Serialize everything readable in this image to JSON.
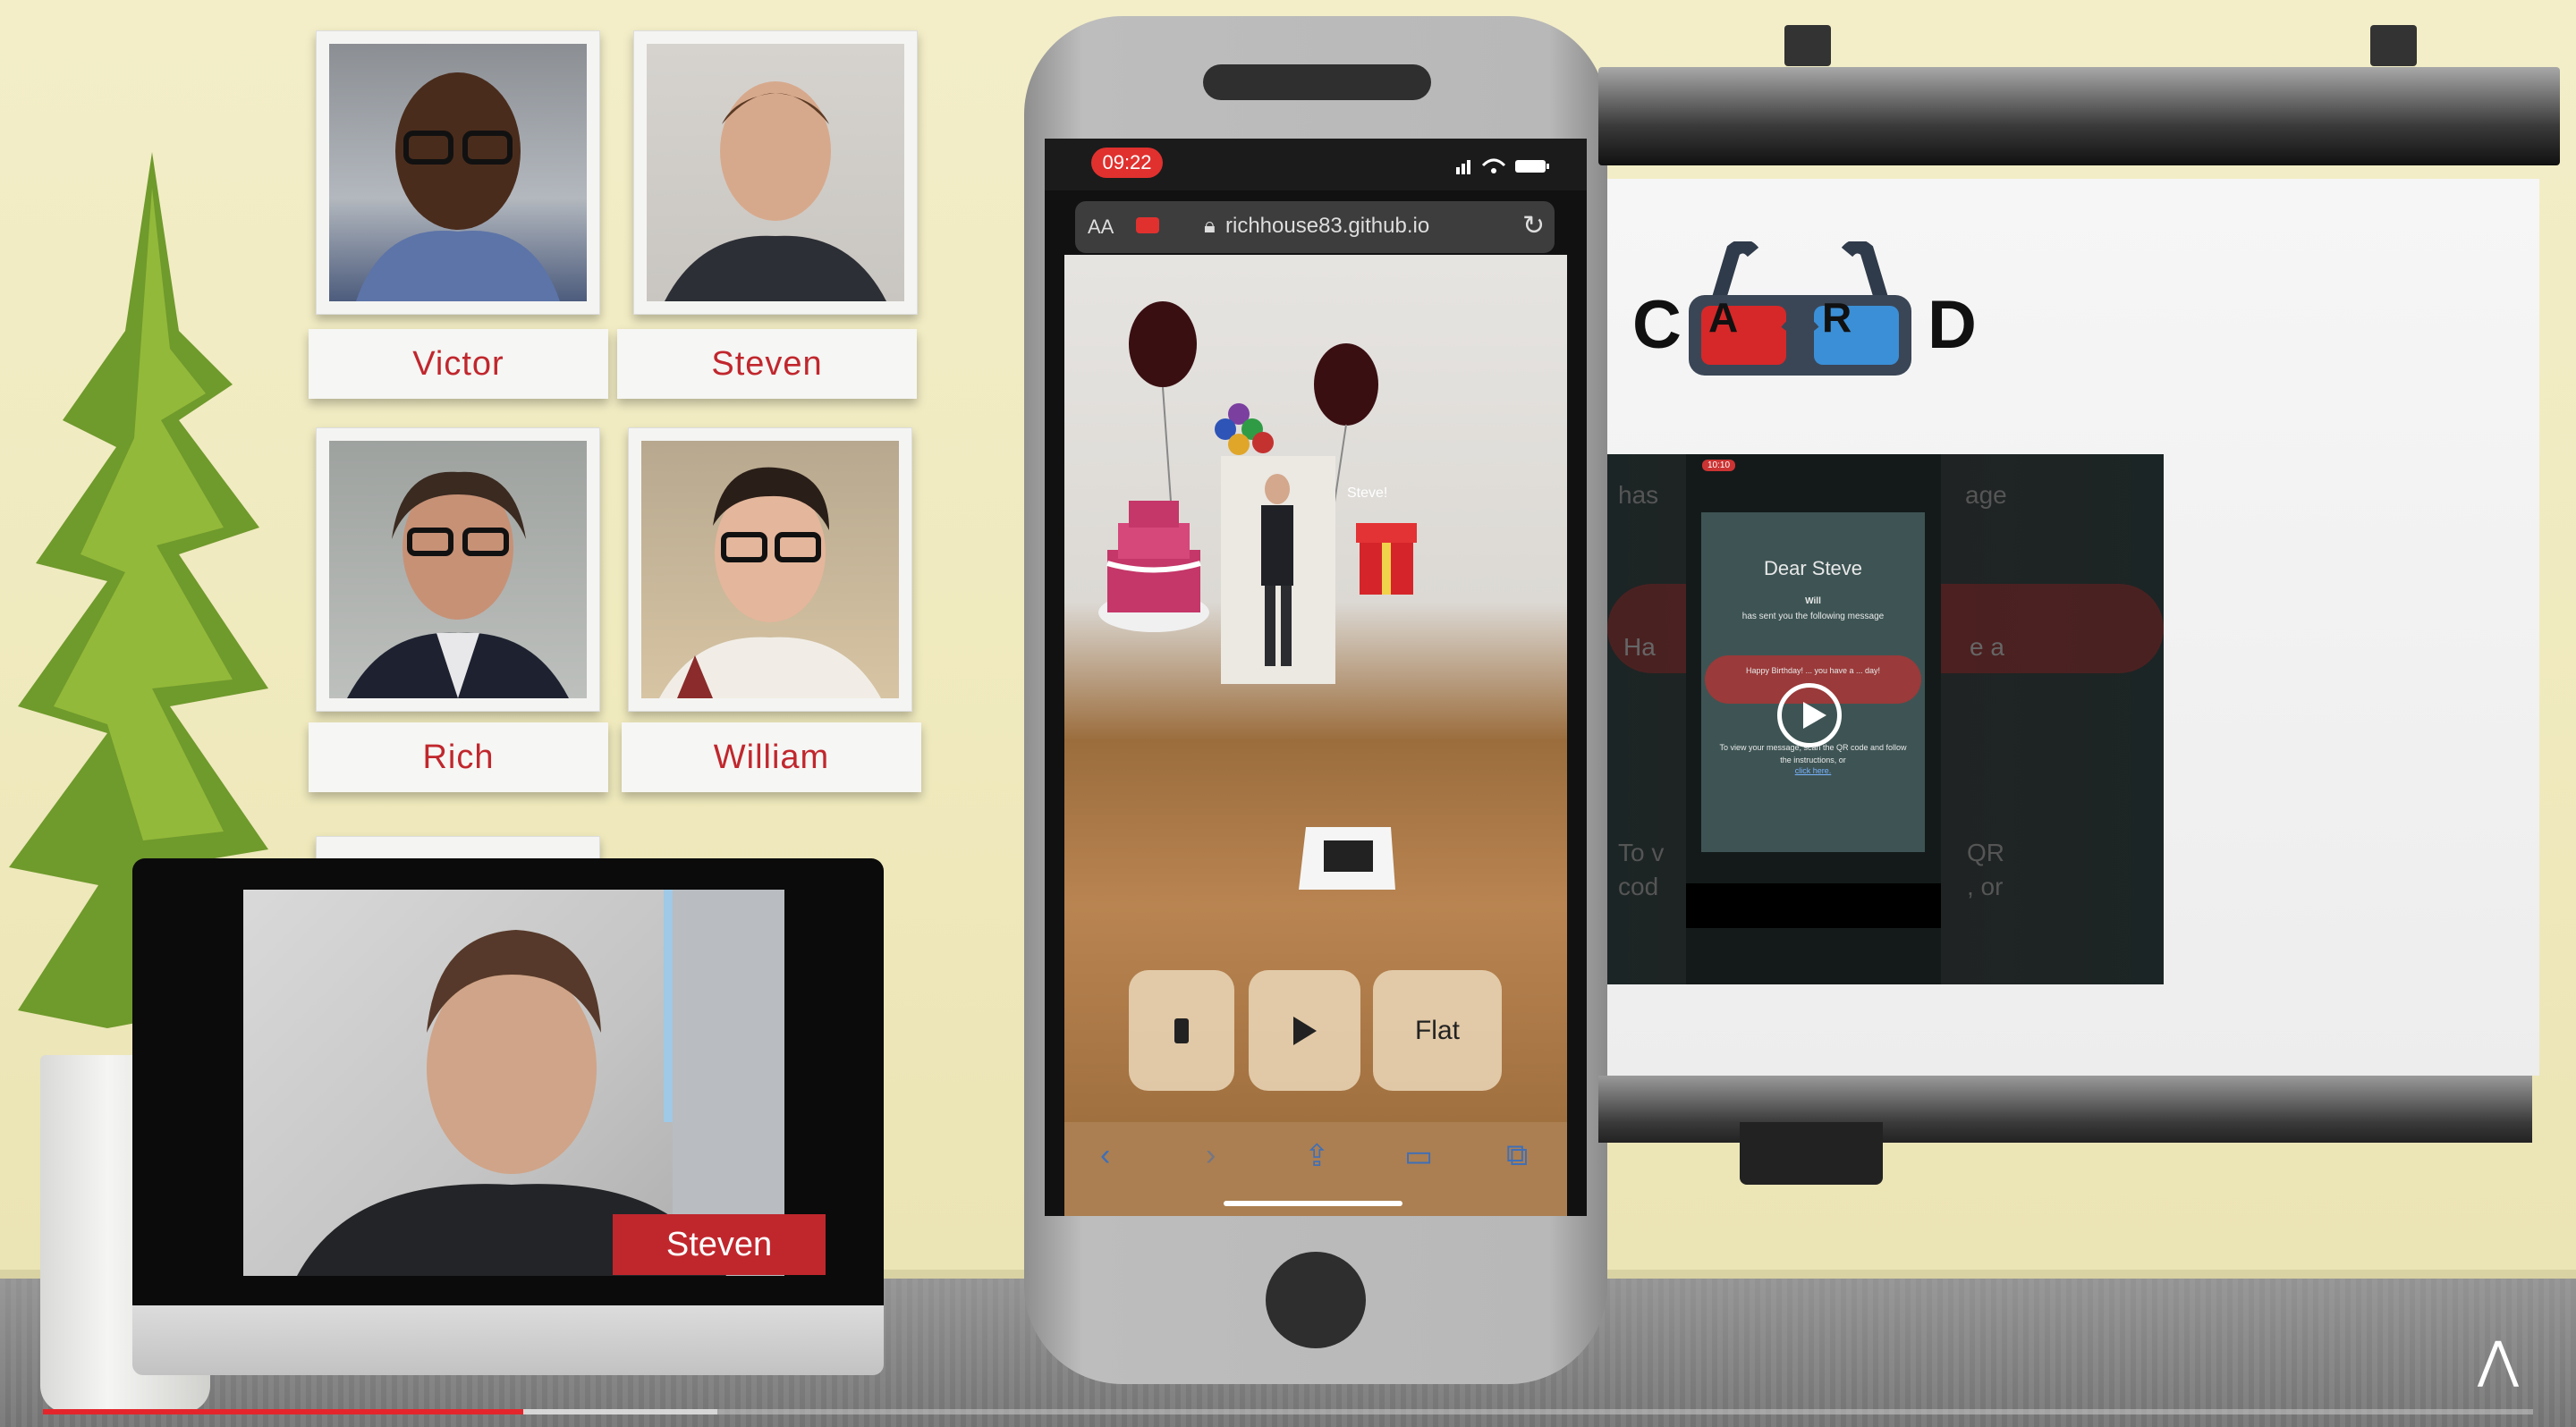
{
  "participants": [
    {
      "name": "Victor"
    },
    {
      "name": "Steven"
    },
    {
      "name": "Rich"
    },
    {
      "name": "William"
    }
  ],
  "speaker": {
    "name": "Steven"
  },
  "phone": {
    "status_time": "09:22",
    "url_text_size": "AA",
    "url": "richhouse83.github.io",
    "ar_label": "Steve!",
    "controls": {
      "flat_label": "Flat"
    }
  },
  "presentation": {
    "logo_left": "C",
    "logo_a": "A",
    "logo_r": "R",
    "logo_right": "D",
    "video": {
      "time": "10:10",
      "greeting": "Dear Steve",
      "sender": "Will",
      "sent_line": "has sent you the following message",
      "bubble_text": "Happy Birthday! ... you have a ... day!",
      "instructions": "To view your message, scan the QR code and follow the instructions, or",
      "link_text": "click here.",
      "bg_left_1": "has",
      "bg_right_1": "age",
      "bg_left_2": "Ha",
      "bg_right_2": "e a",
      "bg_left_3": "To v",
      "bg_right_3": "QR",
      "bg_left_4": "cod",
      "bg_right_4": ", or"
    }
  },
  "video_player": {
    "progress": 0.193,
    "buffered": 0.271,
    "accent": "#e4262c"
  },
  "colors": {
    "name_red": "#c0272d",
    "wall": "#efeac0",
    "anaglyph_red": "#d62828",
    "anaglyph_blue": "#3b8fd6"
  }
}
